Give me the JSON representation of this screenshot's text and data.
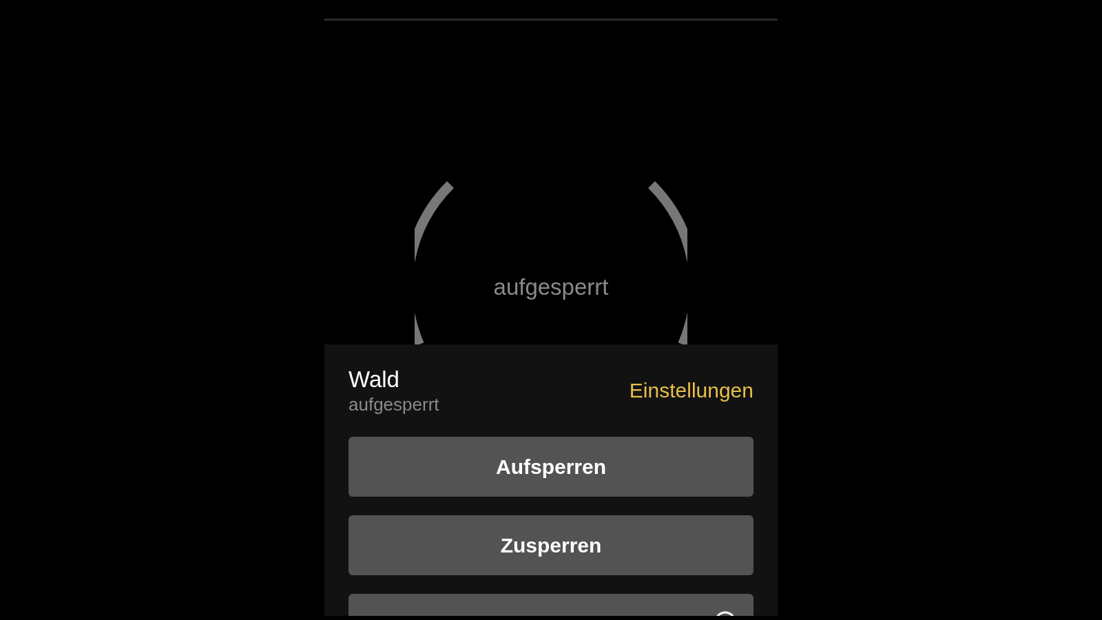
{
  "lock_ring": {
    "status": "aufgesperrt"
  },
  "lock": {
    "name": "Wald",
    "status": "aufgesperrt",
    "settings_link": "Einstellungen"
  },
  "buttons": [
    {
      "label": "Aufsperren"
    },
    {
      "label": "Zusperren"
    }
  ]
}
